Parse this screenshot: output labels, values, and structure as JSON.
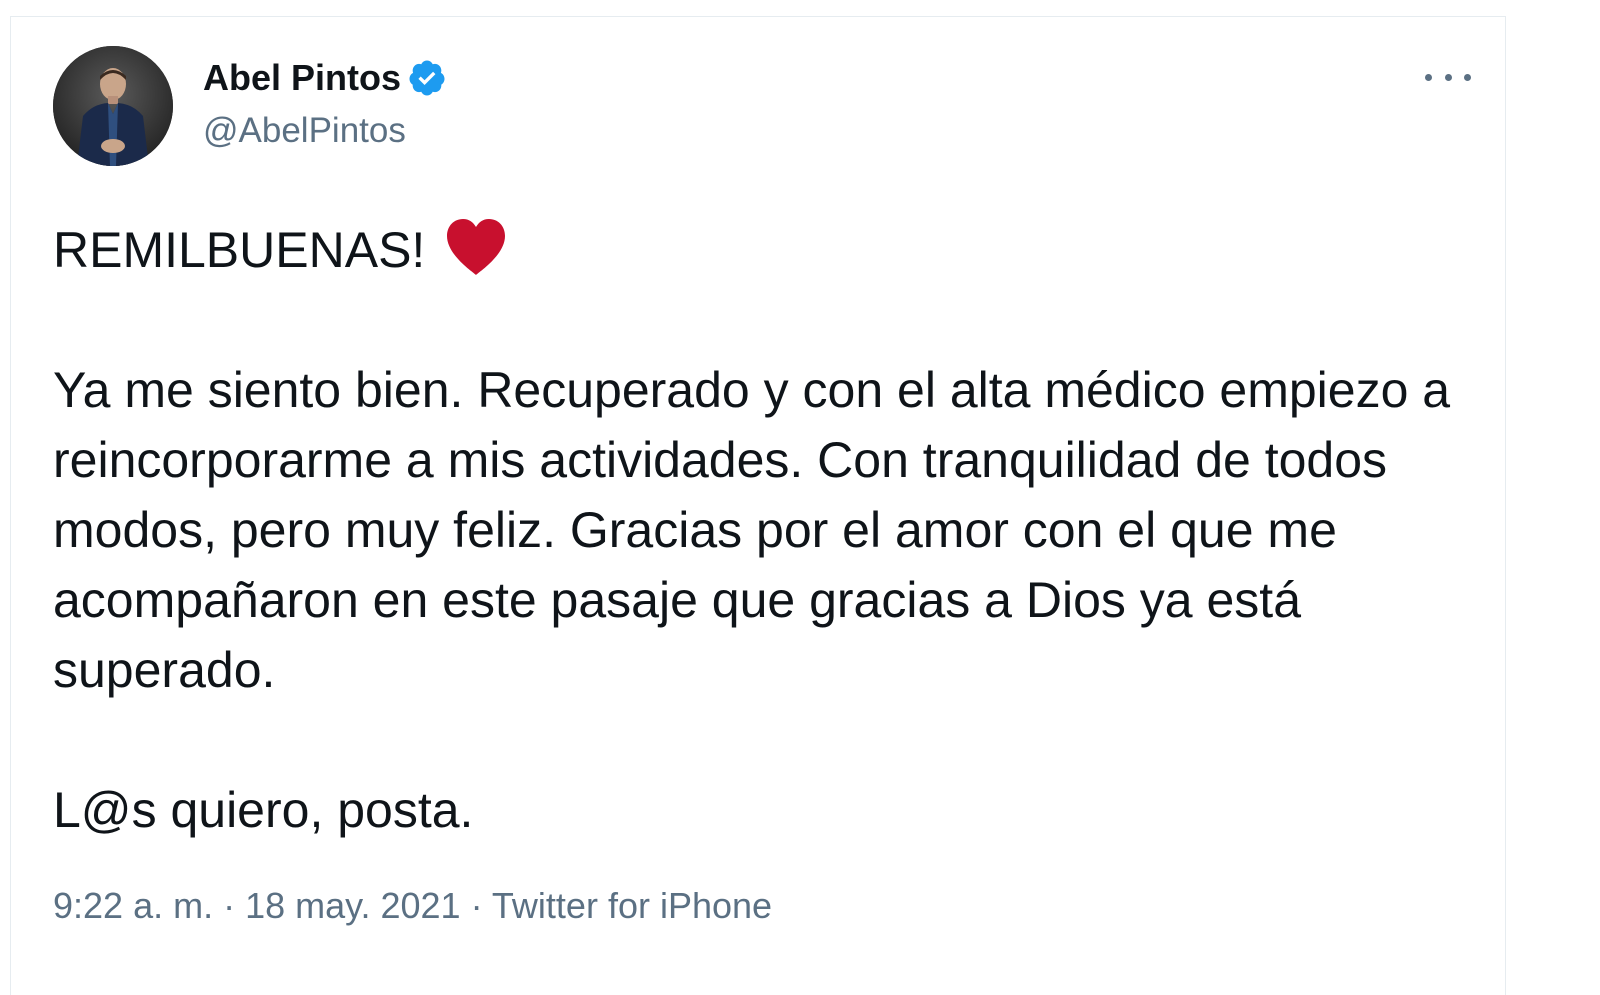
{
  "author": {
    "display_name": "Abel Pintos",
    "handle": "@AbelPintos",
    "verified": true
  },
  "icons": {
    "verified": "verified-badge-icon",
    "more": "more-horizontal-icon",
    "heart": "red-heart-emoji"
  },
  "tweet": {
    "line1": "REMILBUENAS!",
    "paragraph2": "Ya me siento bien. Recuperado y con el alta médico empiezo a reincorporarme a mis actividades. Con tranquilidad de todos modos, pero muy feliz. Gracias por el amor con el que me acompañaron en este pasaje que gracias a Dios ya está superado.",
    "paragraph3": "L@s quiero, posta."
  },
  "meta": {
    "time": "9:22 a. m.",
    "sep1": " · ",
    "date": "18 may. 2021",
    "sep2": " · ",
    "source": "Twitter for iPhone"
  },
  "colors": {
    "accent": "#1d9bf0",
    "text": "#0f1419",
    "secondary": "#5b7083",
    "heart": "#c8102e"
  }
}
